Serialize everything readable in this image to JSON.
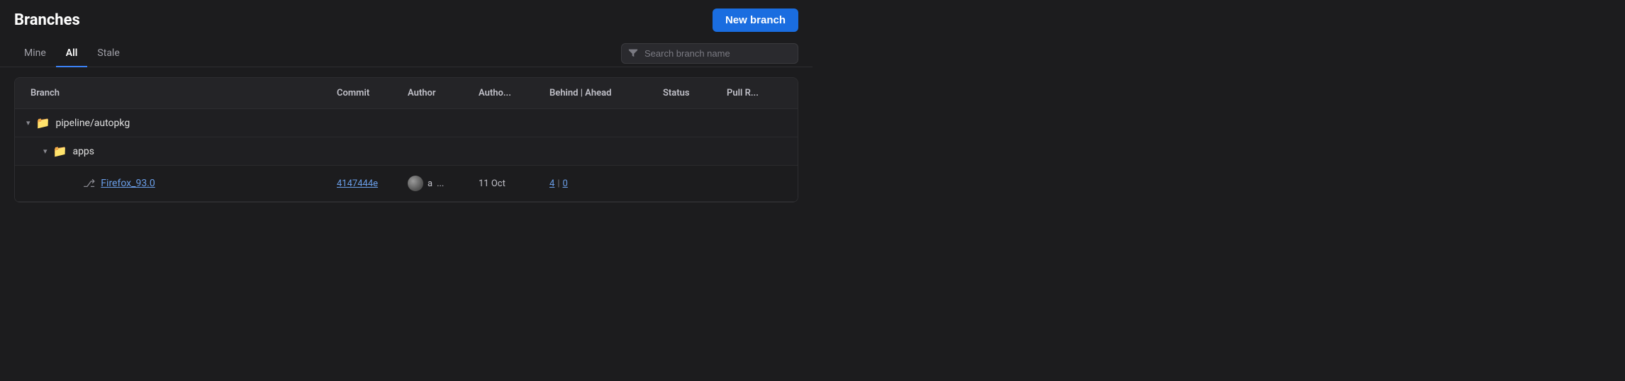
{
  "header": {
    "title": "Branches",
    "new_branch_label": "New branch"
  },
  "tabs": {
    "items": [
      {
        "label": "Mine",
        "active": false
      },
      {
        "label": "All",
        "active": true
      },
      {
        "label": "Stale",
        "active": false
      }
    ]
  },
  "search": {
    "placeholder": "Search branch name"
  },
  "table": {
    "columns": [
      {
        "label": "Branch"
      },
      {
        "label": "Commit"
      },
      {
        "label": "Author"
      },
      {
        "label": "Autho..."
      },
      {
        "label": "Behind | Ahead"
      },
      {
        "label": "Status"
      },
      {
        "label": "Pull R..."
      }
    ],
    "folders": [
      {
        "name": "pipeline/autopkg",
        "depth": 0,
        "subfolders": [
          {
            "name": "apps",
            "depth": 1,
            "branches": [
              {
                "name": "Firefox_93.0",
                "commit_hash": "4147444e",
                "author_initials": "a",
                "author_date": "11 Oct",
                "behind": "4",
                "ahead": "0"
              }
            ]
          }
        ]
      }
    ]
  }
}
